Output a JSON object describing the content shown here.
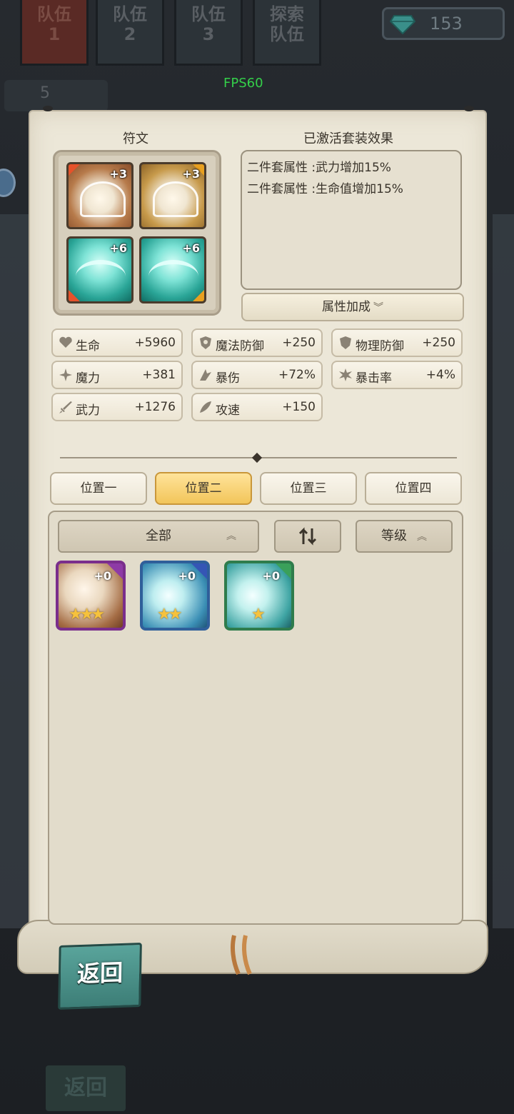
{
  "background": {
    "team_tabs": [
      "队伍\n1",
      "队伍\n2",
      "队伍\n3",
      "探索\n队伍"
    ],
    "gems": "153",
    "squad_count": "5",
    "bg_back_label": "返回"
  },
  "fps": "FPS60",
  "rune_panel": {
    "title": "符文",
    "slots": [
      {
        "level": "+3",
        "color": "brown"
      },
      {
        "level": "+3",
        "color": "gold"
      },
      {
        "level": "+6",
        "color": "teal"
      },
      {
        "level": "+6",
        "color": "teal"
      }
    ]
  },
  "set_panel": {
    "title": "已激活套装效果",
    "effects": [
      "二件套属性 :武力增加15%",
      "二件套属性 :生命值增加15%"
    ],
    "attr_button": "属性加成"
  },
  "stats": [
    {
      "name": "生命",
      "value": "+5960",
      "icon": "heart-icon"
    },
    {
      "name": "魔法防御",
      "value": "+250",
      "icon": "magic-shield-icon"
    },
    {
      "name": "物理防御",
      "value": "+250",
      "icon": "shield-icon"
    },
    {
      "name": "魔力",
      "value": "+381",
      "icon": "sparkle-icon"
    },
    {
      "name": "暴伤",
      "value": "+72%",
      "icon": "crit-damage-icon"
    },
    {
      "name": "暴击率",
      "value": "+4%",
      "icon": "crit-rate-icon"
    },
    {
      "name": "武力",
      "value": "+1276",
      "icon": "sword-icon"
    },
    {
      "name": "攻速",
      "value": "+150",
      "icon": "speed-icon"
    }
  ],
  "positions": {
    "tabs": [
      "位置一",
      "位置二",
      "位置三",
      "位置四"
    ],
    "selected": "位置二"
  },
  "inventory": {
    "filter_all": "全部",
    "sort_label": "等级",
    "items": [
      {
        "level": "+0",
        "stars": 3,
        "rarity_color": "#7a2e8c"
      },
      {
        "level": "+0",
        "stars": 2,
        "rarity_color": "#2f5f9a"
      },
      {
        "level": "+0",
        "stars": 1,
        "rarity_color": "#2f7c4c"
      }
    ]
  },
  "back_button": "返回",
  "colors": {
    "active_tab": "#f2c55a",
    "back_button": "#3d7e77",
    "fps": "#34d04a"
  }
}
